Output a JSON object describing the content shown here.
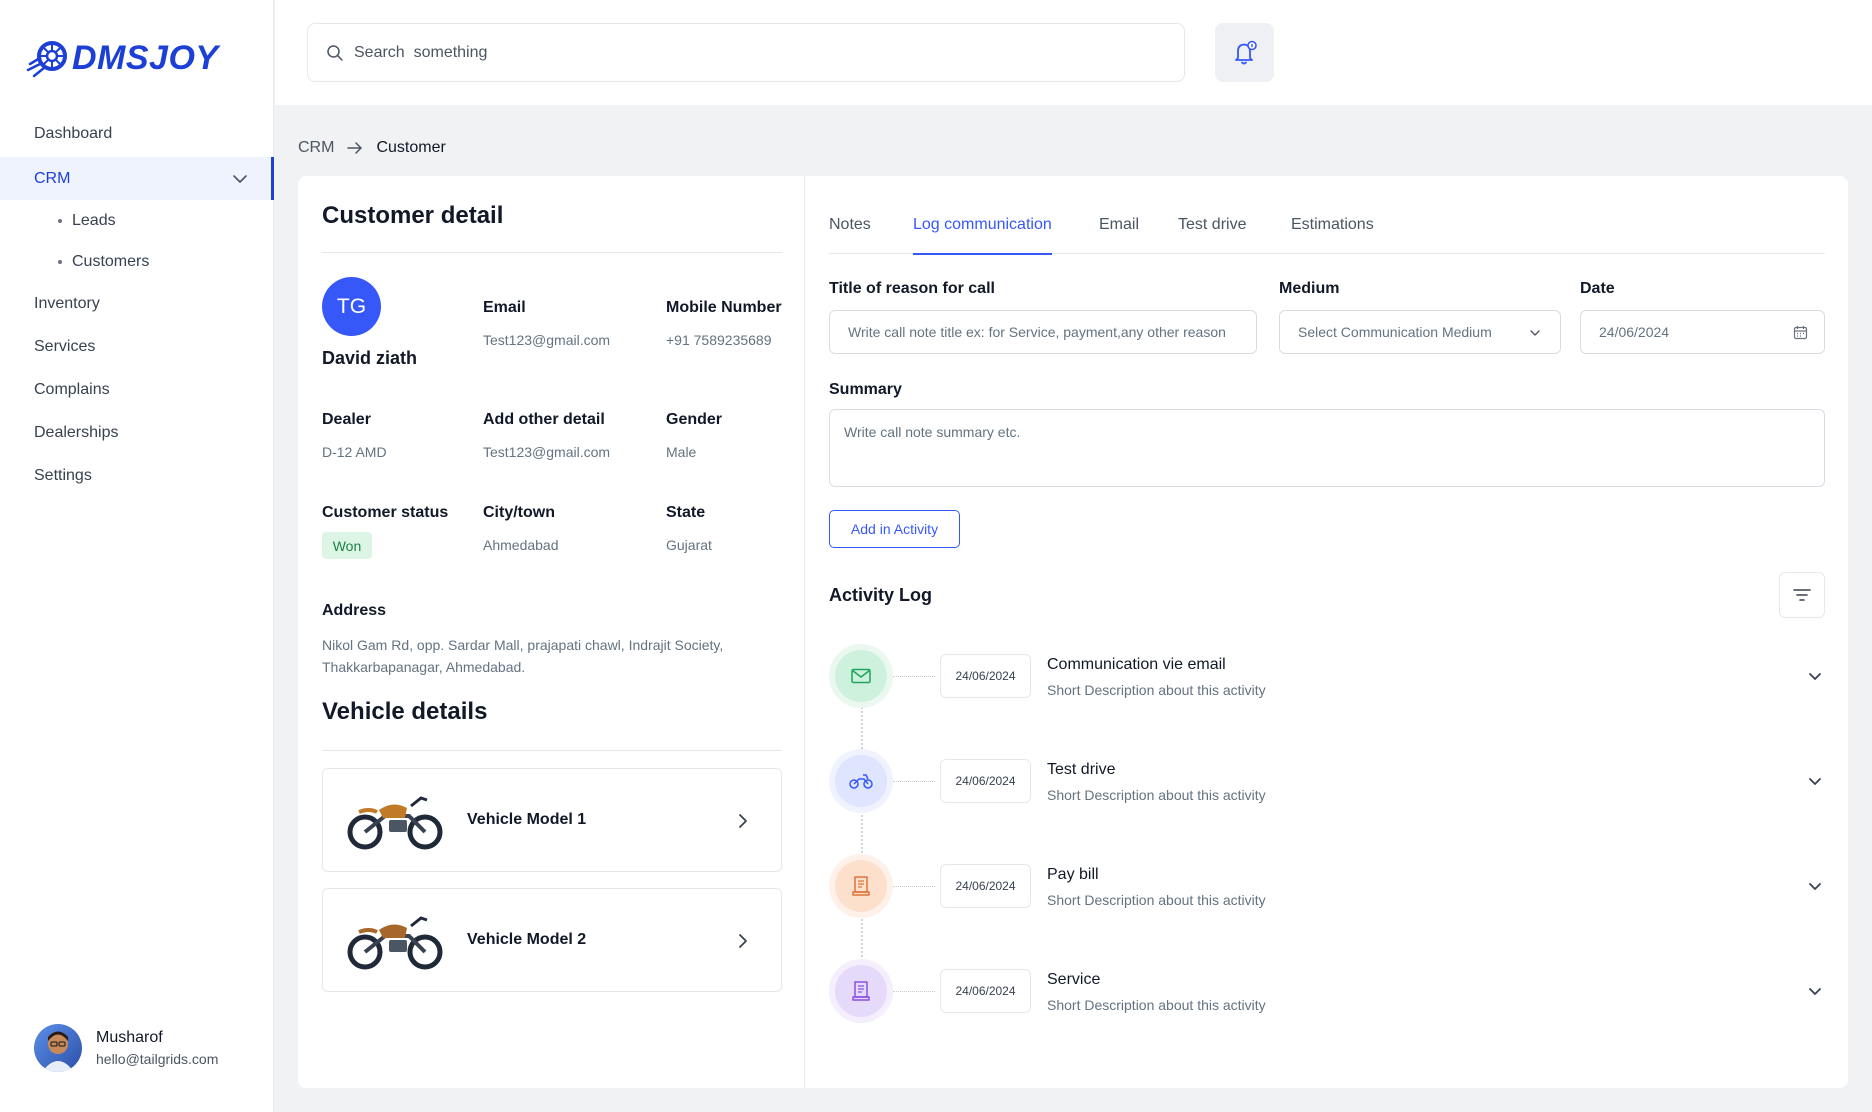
{
  "brand": {
    "name": "DMSJOY",
    "color": "#1c3fd6"
  },
  "sidebar": {
    "items": [
      {
        "label": "Dashboard"
      },
      {
        "label": "CRM",
        "expanded": true,
        "children": [
          {
            "label": "Leads"
          },
          {
            "label": "Customers"
          }
        ]
      },
      {
        "label": "Inventory"
      },
      {
        "label": "Services"
      },
      {
        "label": "Complains"
      },
      {
        "label": "Dealerships"
      },
      {
        "label": "Settings"
      }
    ],
    "profile": {
      "name": "Musharof",
      "email": "hello@tailgrids.com"
    }
  },
  "topbar": {
    "search_placeholder": "Search  something",
    "notification_icon": "bell-icon"
  },
  "breadcrumb": {
    "parent": "CRM",
    "current": "Customer"
  },
  "customer": {
    "section_title": "Customer detail",
    "initials": "TG",
    "name": "David ziath",
    "fields": {
      "email_label": "Email",
      "email": "Test123@gmail.com",
      "mobile_label": "Mobile Number",
      "mobile": "+91 7589235689",
      "dealer_label": "Dealer",
      "dealer": "D-12 AMD",
      "other_label": "Add other detail",
      "other": "Test123@gmail.com",
      "gender_label": "Gender",
      "gender": "Male",
      "status_label": "Customer status",
      "status": "Won",
      "city_label": "City/town",
      "city": "Ahmedabad",
      "state_label": "State",
      "state": "Gujarat",
      "address_label": "Address",
      "address": "Nikol Gam Rd, opp. Sardar Mall, prajapati chawl, Indrajit Society, Thakkarbapanagar, Ahmedabad."
    }
  },
  "vehicles": {
    "section_title": "Vehicle details",
    "items": [
      {
        "name": "Vehicle Model 1"
      },
      {
        "name": "Vehicle Model 2"
      }
    ]
  },
  "tabs": [
    {
      "label": "Notes",
      "active": false
    },
    {
      "label": "Log communication",
      "active": true
    },
    {
      "label": "Email",
      "active": false
    },
    {
      "label": "Test drive",
      "active": false
    },
    {
      "label": "Estimations",
      "active": false
    }
  ],
  "form": {
    "title_label": "Title of reason for call",
    "title_placeholder": "Write call note title ex: for Service, payment,any other reason",
    "medium_label": "Medium",
    "medium_value": "Select Communication Medium",
    "date_label": "Date",
    "date_value": "24/06/2024",
    "summary_label": "Summary",
    "summary_placeholder": "Write call note summary etc.",
    "add_button": "Add in Activity"
  },
  "activity_log": {
    "title": "Activity Log",
    "items": [
      {
        "date": "24/06/2024",
        "title": "Communication vie email",
        "desc": "Short Description about this activity",
        "icon": "mail-icon",
        "color": "#1fa45a",
        "bg": "#d6f3e1"
      },
      {
        "date": "24/06/2024",
        "title": "Test drive",
        "desc": "Short Description about this activity",
        "icon": "motorcycle-icon",
        "color": "#3758f9",
        "bg": "#e3e8fe"
      },
      {
        "date": "24/06/2024",
        "title": "Pay bill",
        "desc": "Short Description about this activity",
        "icon": "receipt-icon",
        "color": "#e0733a",
        "bg": "#fde3d3"
      },
      {
        "date": "24/06/2024",
        "title": "Service",
        "desc": "Short Description about this activity",
        "icon": "document-icon",
        "color": "#8a4fe0",
        "bg": "#ebe0fb"
      }
    ]
  }
}
